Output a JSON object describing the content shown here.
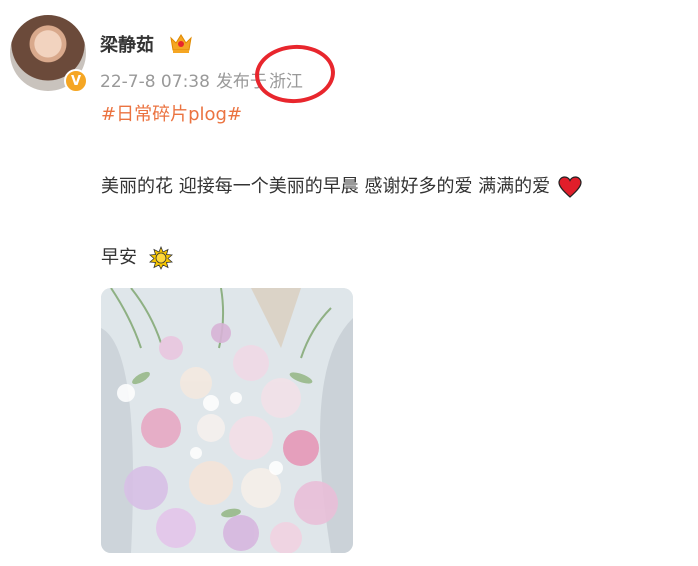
{
  "author": {
    "name": "梁静茹",
    "verified_mark": "V",
    "avatar_icon": "avatar-photo",
    "vip_icon": "crown-icon"
  },
  "meta": {
    "date": "22-7-8 07:38",
    "location_prefix": "发布于",
    "location": "浙江"
  },
  "post": {
    "topic": "#日常碎片plog#",
    "line1": "美丽的花 迎接每一个美丽的早晨 感谢好多的爱 满满的爱",
    "line1_icon": "heart-icon",
    "line2": "早安",
    "line2_icon": "sun-icon",
    "image_icon": "flower-bouquet-photo"
  },
  "colors": {
    "topic": "#eb7340",
    "annotation_circle": "#e8262d",
    "badge": "#f5a623",
    "meta_text": "#999999"
  }
}
